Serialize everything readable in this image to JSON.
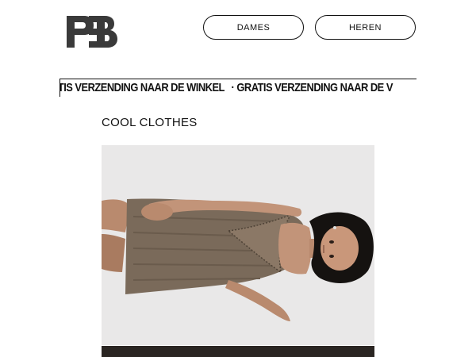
{
  "header": {
    "logo_text": "PB",
    "nav": [
      {
        "label": "DAMES"
      },
      {
        "label": "HEREN"
      }
    ]
  },
  "ticker": {
    "items": [
      "ATIS VERZENDING NAAR DE WINKEL",
      "· GRATIS VERZENDING NAAR DE V"
    ]
  },
  "section": {
    "title": "COOL CLOTHES"
  },
  "colors": {
    "text": "#111111",
    "background": "#ffffff",
    "image_background": "#e9e8e8",
    "dress": "#7a6a5a"
  }
}
